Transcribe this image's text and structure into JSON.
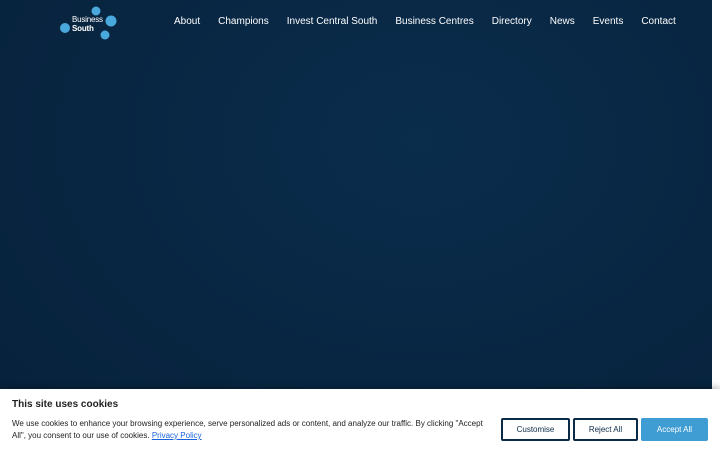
{
  "brand": {
    "logo_line1": "Business",
    "logo_line2": "South",
    "logo_color": "#4aa9dc"
  },
  "nav": {
    "items": [
      {
        "label": "About"
      },
      {
        "label": "Champions"
      },
      {
        "label": "Invest Central South"
      },
      {
        "label": "Business Centres"
      },
      {
        "label": "Directory"
      },
      {
        "label": "News"
      },
      {
        "label": "Events"
      },
      {
        "label": "Contact"
      }
    ]
  },
  "cookie_banner": {
    "title": "This site uses cookies",
    "text": "We use cookies to enhance your browsing experience, serve personalized ads or content, and analyze our traffic. By clicking \"Accept All\", you consent to our use of cookies.",
    "policy_link": "Privacy Policy",
    "customise_label": "Customise",
    "reject_label": "Reject All",
    "accept_label": "Accept All"
  },
  "colors": {
    "background": "#082642",
    "accent": "#3f9dd3",
    "button_border": "#0a2a47",
    "link": "#1863dc"
  }
}
